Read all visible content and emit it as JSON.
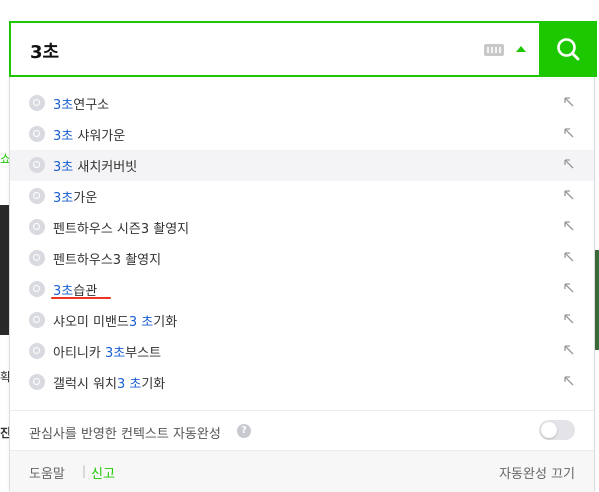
{
  "search": {
    "query": "3초"
  },
  "suggestions": [
    {
      "hit": "3초",
      "rest": "연구소",
      "hit_first": true
    },
    {
      "hit": "3초",
      "rest": " 샤워가운",
      "hit_first": true
    },
    {
      "hit": "3초",
      "rest": " 새치커버빗",
      "hit_first": true
    },
    {
      "hit": "3초",
      "rest": "가운",
      "hit_first": true
    },
    {
      "pre": "펜트하우스 시즌3 촬영지"
    },
    {
      "pre": "펜트하우스3 촬영지"
    },
    {
      "hit": "3초",
      "rest": "습관",
      "hit_first": true
    },
    {
      "pre": "샤오미 미밴드",
      "hit": "3 초",
      "rest": "기화"
    },
    {
      "pre": "아티니카 ",
      "hit": "3초",
      "rest": "부스트"
    },
    {
      "pre": "갤럭시 워치",
      "hit": "3 초",
      "rest": "기화"
    }
  ],
  "context": {
    "label": "관심사를 반영한 컨텍스트 자동완성",
    "help": "?"
  },
  "footer": {
    "help": "도움말",
    "separator": "|",
    "report": "신고",
    "turn_off": "자동완성 끄기"
  },
  "colors": {
    "accent": "#1ec800",
    "highlight_text": "#1a5fd1",
    "underline_mark": "#ee3322"
  }
}
